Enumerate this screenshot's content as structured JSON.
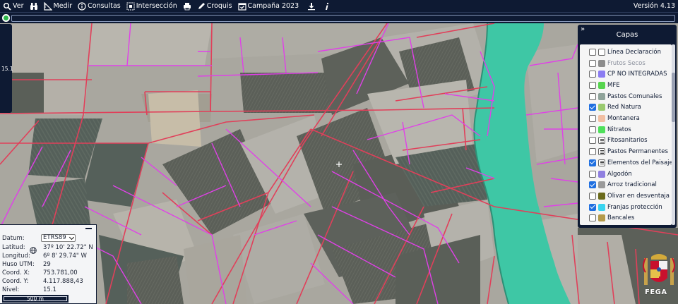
{
  "toolbar": {
    "items": [
      {
        "label": "Ver",
        "icon": "search-icon"
      },
      {
        "label": "",
        "icon": "binoculars-icon"
      },
      {
        "label": "Medir",
        "icon": "ruler-icon"
      },
      {
        "label": "Consultas",
        "icon": "info-icon"
      },
      {
        "label": "Intersección",
        "icon": "intersection-icon"
      },
      {
        "label": "",
        "icon": "print-icon"
      },
      {
        "label": "Croquis",
        "icon": "pencil-icon"
      },
      {
        "label": "Campaña 2023",
        "icon": "calendar-check-icon"
      },
      {
        "label": "",
        "icon": "download-icon"
      },
      {
        "label": "",
        "icon": "italic-info-icon"
      }
    ],
    "version": "Versión 4.13"
  },
  "zoom_level": "15.1",
  "layers": {
    "title": "Capas",
    "collapse_glyph": "»",
    "items": [
      {
        "label": "Línea Declaración",
        "checked": false,
        "color": "#ffffff",
        "swatch": "solid"
      },
      {
        "label": "Frutos Secos",
        "checked": false,
        "color": "#8c8c8c",
        "swatch": "solid",
        "muted": true
      },
      {
        "label": "CP NO INTEGRADAS",
        "checked": false,
        "color": "#8b7cf2",
        "swatch": "solid"
      },
      {
        "label": "MFE",
        "checked": false,
        "color": "#57d44f",
        "swatch": "solid"
      },
      {
        "label": "Pastos Comunales",
        "checked": false,
        "color": "#8fa39a",
        "swatch": "solid"
      },
      {
        "label": "Red Natura",
        "checked": true,
        "color": "#9aca6f",
        "swatch": "solid"
      },
      {
        "label": "Montanera",
        "checked": false,
        "color": "#f2bfa2",
        "swatch": "solid"
      },
      {
        "label": "Nitratos",
        "checked": false,
        "color": "#4fe05a",
        "swatch": "solid"
      },
      {
        "label": "Fitosanitarios",
        "checked": false,
        "color": "#ffffff",
        "swatch": "list"
      },
      {
        "label": "Pastos Permanentes",
        "checked": false,
        "color": "#ffffff",
        "swatch": "list"
      },
      {
        "label": "Elementos del Paisaje",
        "checked": true,
        "color": "#ffffff",
        "swatch": "list"
      },
      {
        "label": "Algodón",
        "checked": false,
        "color": "#8f7fe0",
        "swatch": "solid"
      },
      {
        "label": "Arroz tradicional",
        "checked": true,
        "color": "#9a9a9a",
        "swatch": "solid"
      },
      {
        "label": "Olivar en desventaja",
        "checked": false,
        "color": "#6b6b1c",
        "swatch": "solid"
      },
      {
        "label": "Franjas protección",
        "checked": true,
        "color": "#39d4ef",
        "swatch": "solid"
      },
      {
        "label": "Bancales",
        "checked": false,
        "color": "#b49a4a",
        "swatch": "solid"
      }
    ]
  },
  "coords": {
    "datum_label": "Datum:",
    "datum_value": "ETRS89",
    "lat_label": "Latitud:",
    "lat_value": "37º 10' 22.72\" N",
    "lon_label": "Longitud:",
    "lon_value": "6º 8' 29.74\" W",
    "huso_label": "Huso UTM:",
    "huso_value": "29",
    "x_label": "Coord. X:",
    "x_value": "753.781,00",
    "y_label": "Coord. Y:",
    "y_value": "4.117.888,43",
    "nivel_label": "Nivel:",
    "nivel_value": "15.1",
    "scale": "500 m"
  },
  "logo_text": "FEGA",
  "colors": {
    "toolbar_bg": "#0e1a33",
    "parcel_line": "#e0405a",
    "parcel_line_magenta": "#e040e8",
    "river": "#3ec7a5"
  }
}
